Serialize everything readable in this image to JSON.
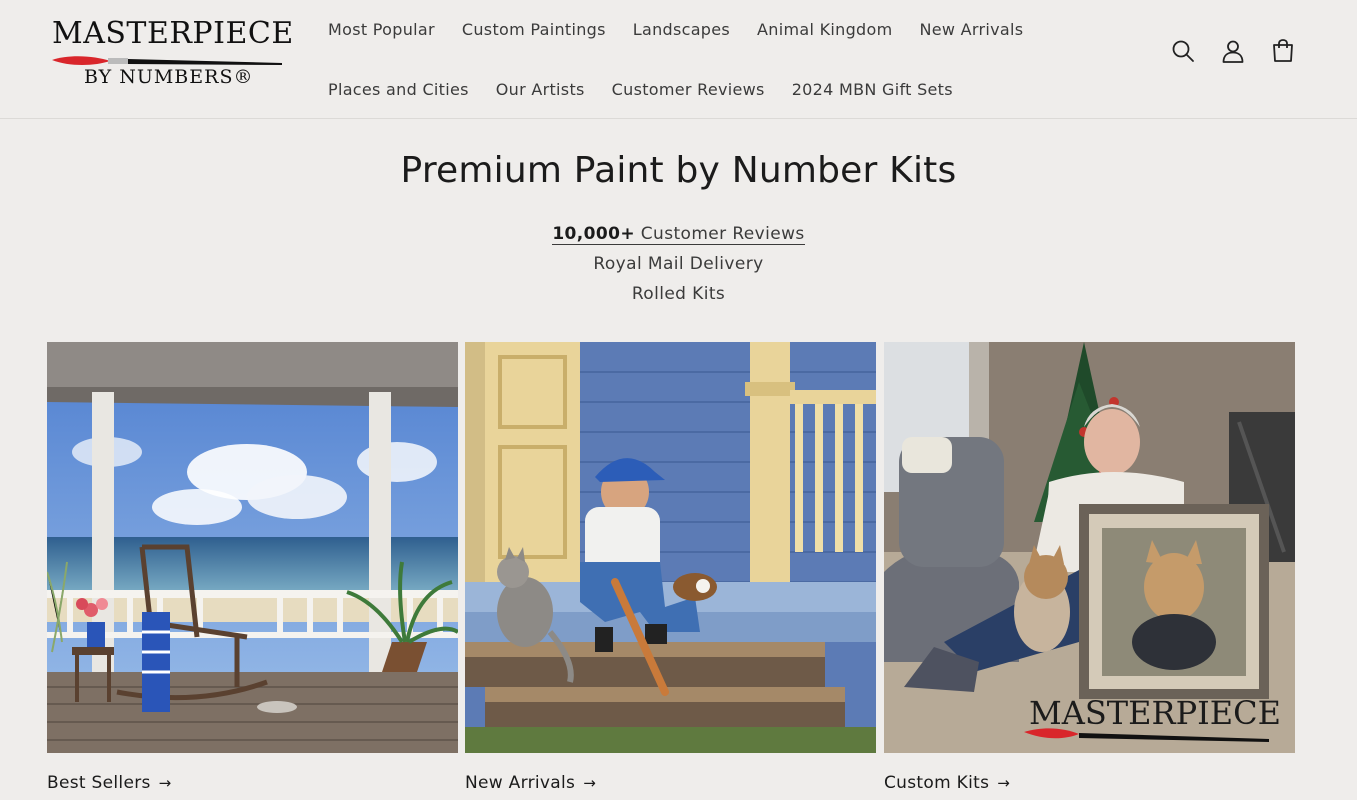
{
  "brand": {
    "logo_line1": "MASTERPIECE",
    "logo_line2": "BY NUMBERS®"
  },
  "nav": {
    "row1": [
      "Most Popular",
      "Custom Paintings",
      "Landscapes",
      "Animal Kingdom",
      "New Arrivals"
    ],
    "row2": [
      "Places and Cities",
      "Our Artists",
      "Customer Reviews",
      "2024 MBN Gift Sets"
    ]
  },
  "header_icons": [
    "search-icon",
    "account-icon",
    "cart-icon"
  ],
  "hero": {
    "title": "Premium Paint by Number Kits",
    "reviews_count": "10,000+",
    "reviews_text": " Customer Reviews",
    "line2": "Royal Mail Delivery",
    "line3": "Rolled Kits"
  },
  "collections": [
    {
      "label": "Best Sellers",
      "arrow": "→",
      "image": "porch-beach-painting"
    },
    {
      "label": "New Arrivals",
      "arrow": "→",
      "image": "boy-cat-porch-painting"
    },
    {
      "label": "Custom Kits",
      "arrow": "→",
      "image": "man-dog-portrait-photo",
      "watermark": "MASTERPIECE"
    }
  ],
  "colors": {
    "background": "#efedeb",
    "text": "#1b1b1b",
    "nav_text": "#3b3b3b",
    "brand_red": "#d9262b"
  }
}
